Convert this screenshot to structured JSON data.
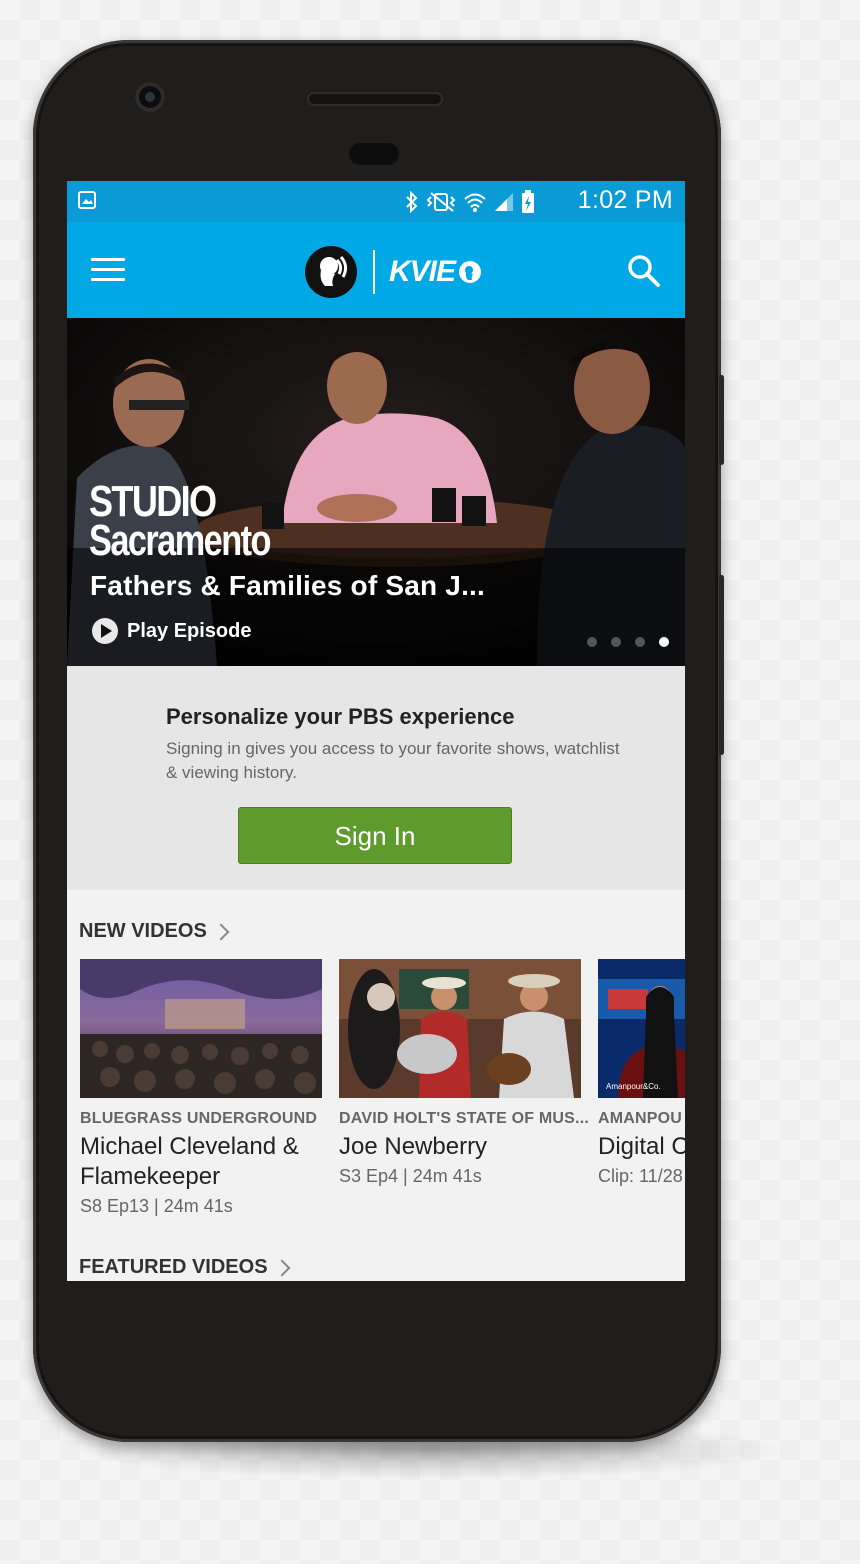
{
  "status_bar": {
    "time": "1:02 PM",
    "icons": [
      "image-icon",
      "bluetooth-icon",
      "vibrate-icon",
      "wifi-icon",
      "signal-icon",
      "battery-icon"
    ]
  },
  "app_bar": {
    "menu_icon": "hamburger-icon",
    "brand": "KVIE",
    "search_icon": "search-icon"
  },
  "hero": {
    "show_logo_line1": "STUDIO",
    "show_logo_line2": "Sacramento",
    "title": "Fathers & Families of San J...",
    "play_label": "Play Episode",
    "carousel_count": 4,
    "carousel_active_index": 3
  },
  "signin": {
    "title": "Personalize your PBS experience",
    "subtitle": "Signing in gives you access to your favorite shows, watchlist & viewing history.",
    "button_label": "Sign In"
  },
  "new_videos": {
    "heading": "NEW VIDEOS",
    "items": [
      {
        "show": "BLUEGRASS UNDERGROUND",
        "title": "Michael Cleveland & Flamekeeper",
        "meta": "S8 Ep13 | 24m 41s"
      },
      {
        "show": "DAVID HOLT'S STATE OF MUS...",
        "title": "Joe Newberry",
        "meta": "S3 Ep4 | 24m 41s"
      },
      {
        "show": "AMANPOU",
        "title": "Digital C Marron",
        "meta": "Clip: 11/28",
        "thumb_text": "Amanpour&Co."
      }
    ]
  },
  "featured_videos": {
    "heading": "FEATURED VIDEOS"
  },
  "colors": {
    "status_bar": "#0a9bd6",
    "app_bar": "#00a8e6",
    "sign_in_button": "#5f9a2c"
  }
}
